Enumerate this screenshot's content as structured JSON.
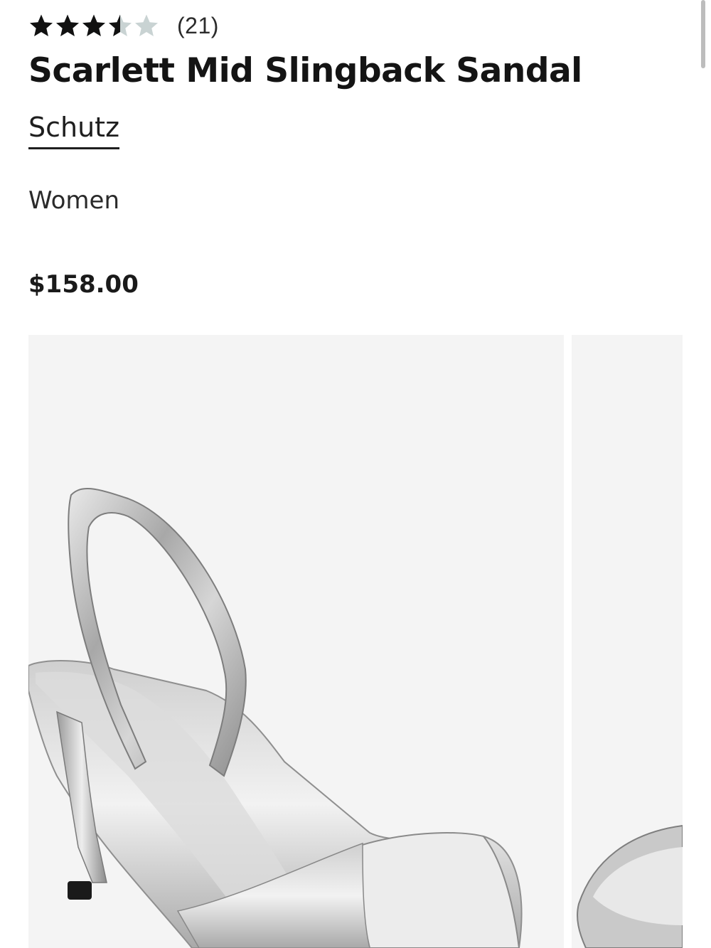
{
  "product": {
    "rating": 3.5,
    "rating_max": 5,
    "review_count": "(21)",
    "title": "Scarlett Mid Slingback Sandal",
    "brand": "Schutz",
    "category": "Women",
    "price": "$158.00"
  },
  "colors": {
    "star_filled": "#111111",
    "star_empty": "#c9d3d3",
    "image_background": "#f4f4f4",
    "text_primary": "#191919"
  },
  "gallery": {
    "images": [
      {
        "description_icon": "silver-slingback-sandal-image"
      },
      {
        "description_icon": "silver-sandal-alternate-view-image"
      }
    ]
  }
}
